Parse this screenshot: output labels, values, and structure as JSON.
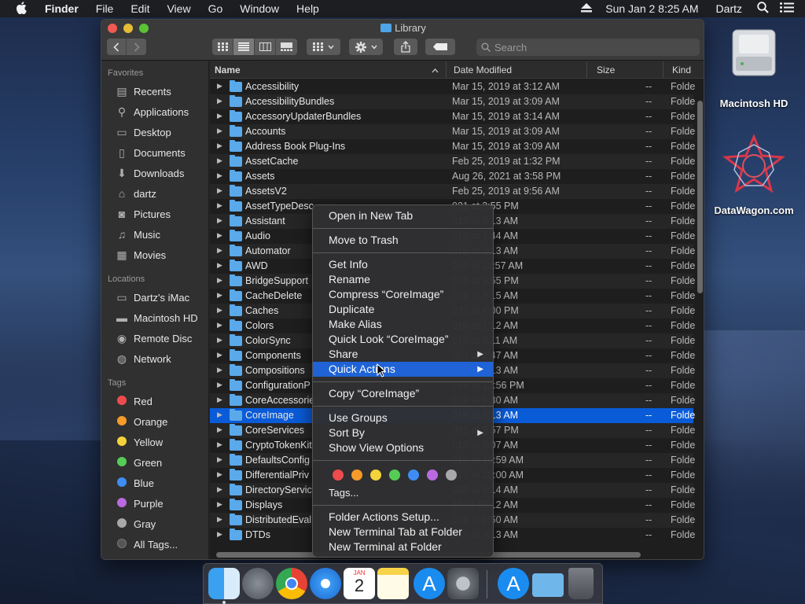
{
  "menubar": {
    "app_name": "Finder",
    "items": [
      "File",
      "Edit",
      "View",
      "Go",
      "Window",
      "Help"
    ],
    "clock": "Sun Jan 2  8:25 AM",
    "user": "Dartz"
  },
  "window": {
    "title": "Library",
    "search_placeholder": "Search"
  },
  "sidebar": {
    "favorites_header": "Favorites",
    "favorites": [
      {
        "label": "Recents",
        "icon": "recents-icon"
      },
      {
        "label": "Applications",
        "icon": "applications-icon"
      },
      {
        "label": "Desktop",
        "icon": "desktop-icon"
      },
      {
        "label": "Documents",
        "icon": "documents-icon"
      },
      {
        "label": "Downloads",
        "icon": "downloads-icon"
      },
      {
        "label": "dartz",
        "icon": "home-icon"
      },
      {
        "label": "Pictures",
        "icon": "pictures-icon"
      },
      {
        "label": "Music",
        "icon": "music-icon"
      },
      {
        "label": "Movies",
        "icon": "movies-icon"
      }
    ],
    "locations_header": "Locations",
    "locations": [
      {
        "label": "Dartz's iMac",
        "icon": "imac-icon"
      },
      {
        "label": "Macintosh HD",
        "icon": "disk-icon"
      },
      {
        "label": "Remote Disc",
        "icon": "disc-icon"
      },
      {
        "label": "Network",
        "icon": "network-icon"
      }
    ],
    "tags_header": "Tags",
    "tags": [
      {
        "label": "Red",
        "color": "#ee4c4c"
      },
      {
        "label": "Orange",
        "color": "#f59b2a"
      },
      {
        "label": "Yellow",
        "color": "#f4d23a"
      },
      {
        "label": "Green",
        "color": "#55cc55"
      },
      {
        "label": "Blue",
        "color": "#3d8df5"
      },
      {
        "label": "Purple",
        "color": "#b96ae0"
      },
      {
        "label": "Gray",
        "color": "#a8a8a8"
      },
      {
        "label": "All Tags...",
        "color": "#555555"
      }
    ]
  },
  "columns": {
    "name": "Name",
    "date": "Date Modified",
    "size": "Size",
    "kind": "Kind"
  },
  "files": [
    {
      "name": "Accessibility",
      "date": "Mar 15, 2019 at 3:12 AM",
      "size": "--",
      "kind": "Folde"
    },
    {
      "name": "AccessibilityBundles",
      "date": "Mar 15, 2019 at 3:09 AM",
      "size": "--",
      "kind": "Folde"
    },
    {
      "name": "AccessoryUpdaterBundles",
      "date": "Mar 15, 2019 at 3:14 AM",
      "size": "--",
      "kind": "Folde"
    },
    {
      "name": "Accounts",
      "date": "Mar 15, 2019 at 3:09 AM",
      "size": "--",
      "kind": "Folde"
    },
    {
      "name": "Address Book Plug-Ins",
      "date": "Mar 15, 2019 at 3:09 AM",
      "size": "--",
      "kind": "Folde"
    },
    {
      "name": "AssetCache",
      "date": "Feb 25, 2019 at 1:32 PM",
      "size": "--",
      "kind": "Folde"
    },
    {
      "name": "Assets",
      "date": "Aug 26, 2021 at 3:58 PM",
      "size": "--",
      "kind": "Folde"
    },
    {
      "name": "AssetsV2",
      "date": "Feb 25, 2019 at 9:56 AM",
      "size": "--",
      "kind": "Folde"
    },
    {
      "name": "AssetTypeDesc",
      "date": "021 at 3:55 PM",
      "size": "--",
      "kind": "Folde"
    },
    {
      "name": "Assistant",
      "date": "019 at 3:13 AM",
      "size": "--",
      "kind": "Folde"
    },
    {
      "name": "Audio",
      "date": "019 at 1:44 AM",
      "size": "--",
      "kind": "Folde"
    },
    {
      "name": "Automator",
      "date": "019 at 3:13 AM",
      "size": "--",
      "kind": "Folde"
    },
    {
      "name": "AWD",
      "date": "019 at 11:57 AM",
      "size": "--",
      "kind": "Folde"
    },
    {
      "name": "BridgeSupport",
      "date": "021 at 3:55 PM",
      "size": "--",
      "kind": "Folde"
    },
    {
      "name": "CacheDelete",
      "date": "019 at 3:15 AM",
      "size": "--",
      "kind": "Folde"
    },
    {
      "name": "Caches",
      "date": "021 at 4:00 PM",
      "size": "--",
      "kind": "Folde"
    },
    {
      "name": "Colors",
      "date": "019 at 1:12 AM",
      "size": "--",
      "kind": "Folde"
    },
    {
      "name": "ColorSync",
      "date": "019 at 3:11 AM",
      "size": "--",
      "kind": "Folde"
    },
    {
      "name": "Components",
      "date": "021 at 2:47 AM",
      "size": "--",
      "kind": "Folde"
    },
    {
      "name": "Compositions",
      "date": "019 at 3:13 AM",
      "size": "--",
      "kind": "Folde"
    },
    {
      "name": "ConfigurationP",
      "date": "019 at 12:56 PM",
      "size": "--",
      "kind": "Folde"
    },
    {
      "name": "CoreAccessorie",
      "date": "019 at 9:30 AM",
      "size": "--",
      "kind": "Folde"
    },
    {
      "name": "CoreImage",
      "date": "019 at 3:13 AM",
      "size": "--",
      "kind": "Folde"
    },
    {
      "name": "CoreServices",
      "date": "021 at 3:57 PM",
      "size": "--",
      "kind": "Folde"
    },
    {
      "name": "CryptoTokenKit",
      "date": "019 at 3:07 AM",
      "size": "--",
      "kind": "Folde"
    },
    {
      "name": "DefaultsConfig",
      "date": "019 at 10:59 AM",
      "size": "--",
      "kind": "Folde"
    },
    {
      "name": "DifferentialPriv",
      "date": "019 at 10:00 AM",
      "size": "--",
      "kind": "Folde"
    },
    {
      "name": "DirectoryServic",
      "date": "019 at 3:14 AM",
      "size": "--",
      "kind": "Folde"
    },
    {
      "name": "Displays",
      "date": "19 at 12:12 AM",
      "size": "--",
      "kind": "Folde"
    },
    {
      "name": "DistributedEval",
      "date": "019 at 1:50 AM",
      "size": "--",
      "kind": "Folde"
    },
    {
      "name": "DTDs",
      "date": "019 at 3:13 AM",
      "size": "--",
      "kind": "Folde"
    }
  ],
  "context_menu": {
    "open_new_tab": "Open in New Tab",
    "move_to_trash": "Move to Trash",
    "get_info": "Get Info",
    "rename": "Rename",
    "compress": "Compress “CoreImage”",
    "duplicate": "Duplicate",
    "make_alias": "Make Alias",
    "quick_look": "Quick Look “CoreImage”",
    "share": "Share",
    "quick_actions": "Quick Actions",
    "copy": "Copy “CoreImage”",
    "use_groups": "Use Groups",
    "sort_by": "Sort By",
    "show_view_options": "Show View Options",
    "tags": "Tags...",
    "tag_colors": [
      "#ee4c4c",
      "#f59b2a",
      "#f4d23a",
      "#55cc55",
      "#3d8df5",
      "#b96ae0",
      "#a8a8a8"
    ],
    "folder_actions": "Folder Actions Setup...",
    "new_terminal_tab": "New Terminal Tab at Folder",
    "new_terminal": "New Terminal at Folder"
  },
  "desktop": {
    "disk_label": "Macintosh HD",
    "datawagon_label": "DataWagon.com"
  },
  "dock": {
    "apps": [
      "finder-icon",
      "launchpad-icon",
      "chrome-icon",
      "safari-icon",
      "calendar-icon",
      "notes-icon",
      "app-store-icon",
      "system-preferences-icon",
      "app-store-icon",
      "downloads-folder-icon",
      "trash-icon"
    ],
    "calendar_month": "JAN",
    "calendar_day": "2"
  }
}
